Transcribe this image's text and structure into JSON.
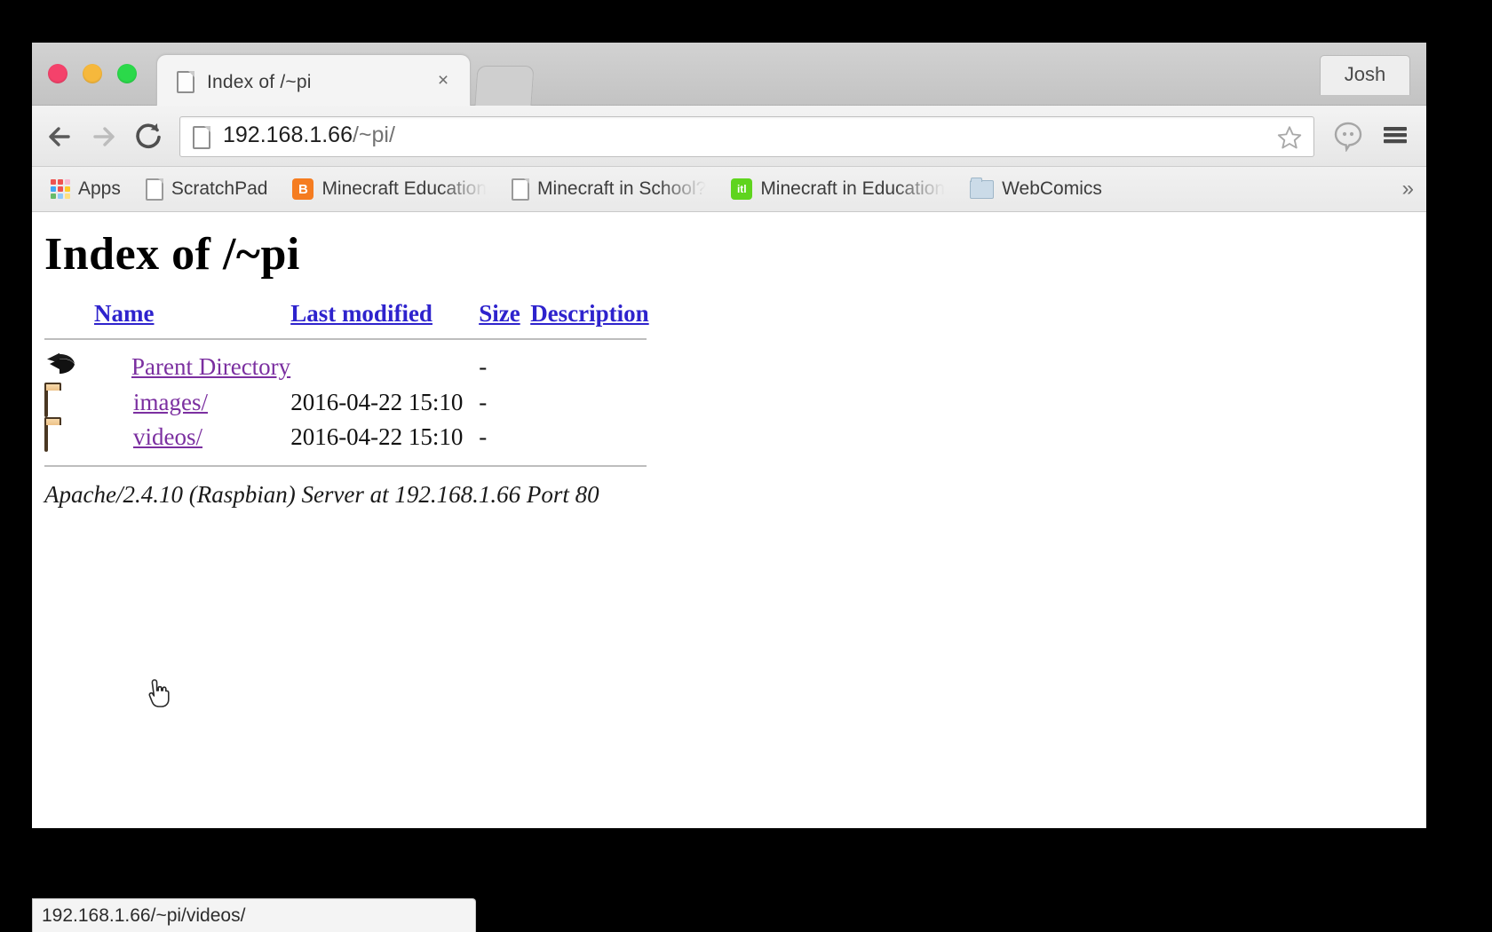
{
  "window": {
    "traffic_lights": [
      {
        "name": "close",
        "color": "#f4426b"
      },
      {
        "name": "minimize",
        "color": "#f6b83c"
      },
      {
        "name": "maximize",
        "color": "#2bd94a"
      }
    ],
    "profile_label": "Josh"
  },
  "tabs": {
    "active": {
      "title": "Index of /~pi",
      "close_label": "×"
    },
    "new_tab_label": ""
  },
  "toolbar": {
    "back_icon": "arrow-left-icon",
    "forward_icon": "arrow-right-icon",
    "reload_icon": "reload-icon",
    "url_host": "192.168.1.66",
    "url_path": "/~pi/",
    "url_full": "192.168.1.66/~pi/",
    "star_icon": "star-icon",
    "hangouts_icon": "hangouts-icon",
    "menu_icon": "hamburger-menu-icon"
  },
  "bookmarks": {
    "overflow_label": "»",
    "items": [
      {
        "label": "Apps",
        "icon": "apps-grid-icon",
        "truncated": false
      },
      {
        "label": "ScratchPad",
        "icon": "document-icon",
        "truncated": false
      },
      {
        "label": "Minecraft Education",
        "icon": "blogger-b-icon",
        "truncated": false,
        "icon_color": "#f57c20",
        "icon_text": "B"
      },
      {
        "label": "Minecraft in School?",
        "icon": "document-icon",
        "truncated": true
      },
      {
        "label": "Minecraft in Education",
        "icon": "green-site-icon",
        "truncated": true,
        "icon_color": "#5fd41e",
        "icon_text": "itl"
      },
      {
        "label": "WebComics",
        "icon": "folder-icon",
        "truncated": false
      }
    ]
  },
  "page": {
    "heading": "Index of /~pi",
    "columns": [
      {
        "label": "Name"
      },
      {
        "label": "Last modified"
      },
      {
        "label": "Size"
      },
      {
        "label": "Description"
      }
    ],
    "rows": [
      {
        "icon": "back-arrow-icon",
        "name": "Parent Directory",
        "modified": "",
        "size": "-",
        "description": ""
      },
      {
        "icon": "folder-icon",
        "name": "images/",
        "modified": "2016-04-22 15:10",
        "size": "-",
        "description": ""
      },
      {
        "icon": "folder-icon",
        "name": "videos/",
        "modified": "2016-04-22 15:10",
        "size": "-",
        "description": ""
      }
    ],
    "footer": "Apache/2.4.10 (Raspbian) Server at 192.168.1.66 Port 80",
    "link_color": "#7b2fa0",
    "header_link_color": "#2e23cd"
  },
  "status": {
    "text": "192.168.1.66/~pi/videos/"
  }
}
